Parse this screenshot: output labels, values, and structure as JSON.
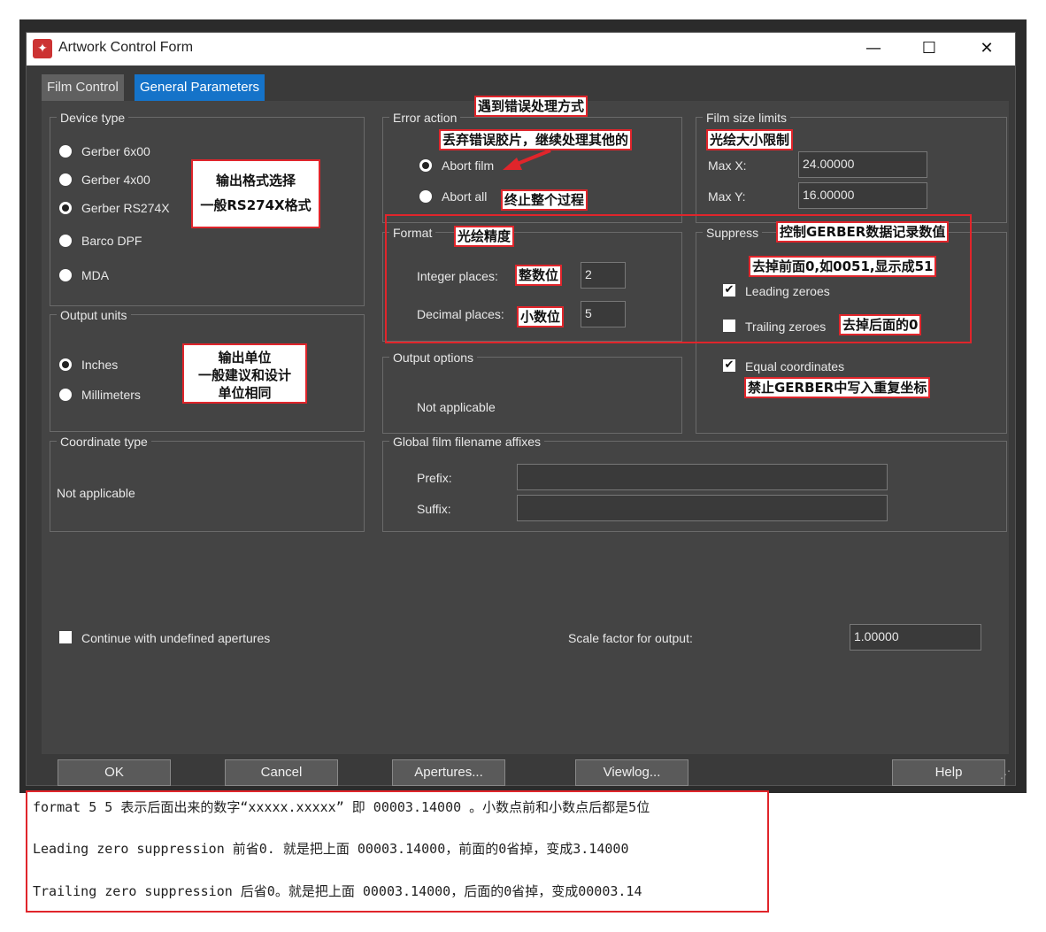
{
  "window": {
    "title": "Artwork Control Form",
    "minimize": "—",
    "maximize": "☐",
    "close": "✕"
  },
  "tabs": [
    "Film Control",
    "General Parameters"
  ],
  "device_type": {
    "label": "Device type",
    "options": [
      "Gerber 6x00",
      "Gerber 4x00",
      "Gerber RS274X",
      "Barco DPF",
      "MDA"
    ],
    "selected": 2
  },
  "error_action": {
    "label": "Error action",
    "options": [
      "Abort film",
      "Abort all"
    ],
    "selected": 0
  },
  "film_size": {
    "label": "Film size limits",
    "max_x_label": "Max X:",
    "max_x": "24.00000",
    "max_y_label": "Max Y:",
    "max_y": "16.00000"
  },
  "output_units": {
    "label": "Output units",
    "options": [
      "Inches",
      "Millimeters"
    ],
    "selected": 0
  },
  "format": {
    "label": "Format",
    "integer_label": "Integer places:",
    "integer": "2",
    "decimal_label": "Decimal places:",
    "decimal": "5"
  },
  "suppress": {
    "label": "Suppress",
    "leading": "Leading zeroes",
    "leading_checked": true,
    "trailing": "Trailing zeroes",
    "trailing_checked": false,
    "equal": "Equal coordinates",
    "equal_checked": true
  },
  "output_options": {
    "label": "Output options",
    "text": "Not applicable"
  },
  "coordinate_type": {
    "label": "Coordinate type",
    "text": "Not applicable"
  },
  "affixes": {
    "label": "Global film filename affixes",
    "prefix_label": "Prefix:",
    "prefix": "",
    "suffix_label": "Suffix:",
    "suffix": ""
  },
  "continue_undefined": {
    "label": "Continue with undefined apertures",
    "checked": false
  },
  "scale": {
    "label": "Scale factor for output:",
    "value": "1.00000"
  },
  "buttons": [
    "OK",
    "Cancel",
    "Apertures...",
    "Viewlog...",
    "Help"
  ],
  "annotations": {
    "device_format_1": "输出格式选择",
    "device_format_2": "一般RS274X格式",
    "error_method": "遇到错误处理方式",
    "abort_film": "丢弃错误胶片，继续处理其他的",
    "abort_all": "终止整个过程",
    "film_size": "光绘大小限制",
    "format_precision": "光绘精度",
    "integer": "整数位",
    "decimal": "小数位",
    "suppress": "控制GERBER数据记录数值",
    "leading": "去掉前面0,如0051,显示成51",
    "trailing": "去掉后面的0",
    "equal": "禁止GERBER中写入重复坐标",
    "units_1": "输出单位",
    "units_2": "一般建议和设计",
    "units_3": "单位相同"
  },
  "notes": [
    "format 5 5 表示后面出来的数字“xxxxx.xxxxx” 即 00003.14000 。小数点前和小数点后都是5位",
    "Leading zero suppression 前省0. 就是把上面 00003.14000，前面的0省掉，变成3.14000",
    "Trailing zero suppression 后省0。就是把上面 00003.14000，后面的0省掉，变成00003.14"
  ],
  "colors": {
    "accent": "#1573c9",
    "annotation_border": "#e0252b",
    "panel": "#444444"
  }
}
